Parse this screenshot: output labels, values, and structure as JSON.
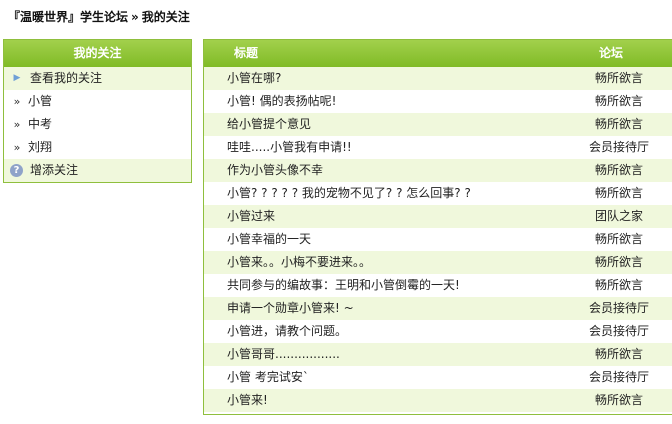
{
  "breadcrumb": {
    "site": "『温暖世界』学生论坛",
    "separator": "»",
    "current": "我的关注"
  },
  "left_panel": {
    "title": "我的关注",
    "items": [
      {
        "label": "查看我的关注",
        "icon": "triangle-right-icon"
      },
      {
        "label": "小管",
        "icon": "double-chevron-icon"
      },
      {
        "label": "中考",
        "icon": "double-chevron-icon"
      },
      {
        "label": "刘翔",
        "icon": "double-chevron-icon"
      },
      {
        "label": "增添关注",
        "icon": "help-icon"
      }
    ]
  },
  "table": {
    "headers": {
      "title": "标题",
      "forum": "论坛"
    },
    "rows": [
      {
        "title": "小管在哪?",
        "forum": "畅所欲言"
      },
      {
        "title": "小管! 偶的表扬帖呢!",
        "forum": "畅所欲言"
      },
      {
        "title": "给小管提个意见",
        "forum": "畅所欲言"
      },
      {
        "title": "哇哇.....小管我有申请!!",
        "forum": "会员接待厅"
      },
      {
        "title": "作为小管头像不幸",
        "forum": "畅所欲言"
      },
      {
        "title": "小管? ? ? ? ? 我的宠物不见了? ? 怎么回事? ?",
        "forum": "畅所欲言"
      },
      {
        "title": "小管过来",
        "forum": "团队之家"
      },
      {
        "title": "小管幸福的一天",
        "forum": "畅所欲言"
      },
      {
        "title": "小管来。。小梅不要进来。。",
        "forum": "畅所欲言"
      },
      {
        "title": "共同参与的编故事：王明和小管倒霉的一天!",
        "forum": "畅所欲言"
      },
      {
        "title": "申请一个勋章小管来! ~",
        "forum": "会员接待厅"
      },
      {
        "title": "小管进，请教个问题。",
        "forum": "会员接待厅"
      },
      {
        "title": "小管哥哥.................",
        "forum": "畅所欲言"
      },
      {
        "title": "小管 考完试安`",
        "forum": "会员接待厅"
      },
      {
        "title": "小管来!",
        "forum": "畅所欲言"
      }
    ]
  }
}
